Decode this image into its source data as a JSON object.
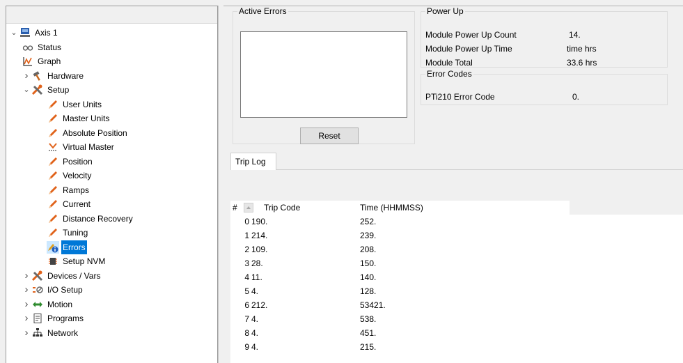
{
  "tree": {
    "items": [
      {
        "label": "Axis 1",
        "icon": "drive-icon",
        "expander": "open",
        "indent": 0
      },
      {
        "label": "Status",
        "icon": "glasses-icon",
        "expander": "",
        "indent": 1
      },
      {
        "label": "Graph",
        "icon": "graph-icon",
        "expander": "",
        "indent": 1
      },
      {
        "label": "Hardware",
        "icon": "hammer-icon",
        "expander": "closed",
        "indent": 1
      },
      {
        "label": "Setup",
        "icon": "tools-icon",
        "expander": "open",
        "indent": 1
      },
      {
        "label": "User Units",
        "icon": "pencil-icon",
        "expander": "",
        "indent": 2
      },
      {
        "label": "Master Units",
        "icon": "pencil-icon",
        "expander": "",
        "indent": 2
      },
      {
        "label": "Absolute Position",
        "icon": "pencil-icon",
        "expander": "",
        "indent": 2
      },
      {
        "label": "Virtual Master",
        "icon": "virtual-master-icon",
        "expander": "",
        "indent": 2
      },
      {
        "label": "Position",
        "icon": "pencil-icon",
        "expander": "",
        "indent": 2
      },
      {
        "label": "Velocity",
        "icon": "pencil-icon",
        "expander": "",
        "indent": 2
      },
      {
        "label": "Ramps",
        "icon": "pencil-icon",
        "expander": "",
        "indent": 2
      },
      {
        "label": "Current",
        "icon": "pencil-icon",
        "expander": "",
        "indent": 2
      },
      {
        "label": "Distance Recovery",
        "icon": "pencil-icon",
        "expander": "",
        "indent": 2
      },
      {
        "label": "Tuning",
        "icon": "pencil-icon",
        "expander": "",
        "indent": 2
      },
      {
        "label": "Errors",
        "icon": "errors-info-icon",
        "expander": "",
        "indent": 2,
        "selected": true
      },
      {
        "label": "Setup NVM",
        "icon": "nvm-chip-icon",
        "expander": "",
        "indent": 2
      },
      {
        "label": "Devices / Vars",
        "icon": "tools-icon",
        "expander": "closed",
        "indent": 1
      },
      {
        "label": "I/O Setup",
        "icon": "io-icon",
        "expander": "closed",
        "indent": 1
      },
      {
        "label": "Motion",
        "icon": "double-arrow-icon",
        "expander": "closed",
        "indent": 1
      },
      {
        "label": "Programs",
        "icon": "document-icon",
        "expander": "closed",
        "indent": 1
      },
      {
        "label": "Network",
        "icon": "network-icon",
        "expander": "closed",
        "indent": 1
      }
    ]
  },
  "active_errors": {
    "title": "Active Errors",
    "reset_label": "Reset"
  },
  "power_up": {
    "title": "Power Up",
    "rows": [
      {
        "label": "Module Power Up Count",
        "value": "14."
      },
      {
        "label": "Module Power Up Time",
        "value": "time  hrs"
      },
      {
        "label": "Module Total",
        "value": "33.6  hrs"
      }
    ]
  },
  "error_codes": {
    "title": "Error Codes",
    "rows": [
      {
        "label": "PTi210 Error Code",
        "value": "0."
      }
    ]
  },
  "trip_log": {
    "tab_label": "Trip Log",
    "columns": {
      "index": "#",
      "code": "Trip Code",
      "time": "Time (HHMMSS)"
    },
    "rows": [
      {
        "index": "0",
        "code": "190.",
        "time": "252."
      },
      {
        "index": "1",
        "code": "214.",
        "time": "239."
      },
      {
        "index": "2",
        "code": "109.",
        "time": "208."
      },
      {
        "index": "3",
        "code": "28.",
        "time": "150."
      },
      {
        "index": "4",
        "code": "11.",
        "time": "140."
      },
      {
        "index": "5",
        "code": "4.",
        "time": "128."
      },
      {
        "index": "6",
        "code": "212.",
        "time": "53421."
      },
      {
        "index": "7",
        "code": "4.",
        "time": "538."
      },
      {
        "index": "8",
        "code": "4.",
        "time": "451."
      },
      {
        "index": "9",
        "code": "4.",
        "time": "215."
      }
    ]
  }
}
